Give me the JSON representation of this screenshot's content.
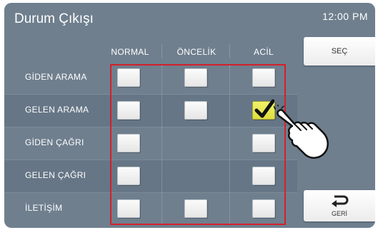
{
  "header": {
    "title": "Durum Çıkışı",
    "clock": "12:00 PM"
  },
  "columns": [
    "NORMAL",
    "ÖNCELİK",
    "ACİL"
  ],
  "rows": [
    {
      "label": "GİDEN ARAMA",
      "cells": [
        false,
        false,
        false
      ],
      "present": [
        true,
        true,
        true
      ]
    },
    {
      "label": "GELEN ARAMA",
      "cells": [
        false,
        false,
        true
      ],
      "present": [
        true,
        true,
        true
      ]
    },
    {
      "label": "GİDEN ÇAĞRI",
      "cells": [
        false,
        false,
        false
      ],
      "present": [
        true,
        false,
        true
      ]
    },
    {
      "label": "GELEN ÇAĞRI",
      "cells": [
        false,
        false,
        false
      ],
      "present": [
        true,
        false,
        true
      ]
    },
    {
      "label": "İLETİŞİM",
      "cells": [
        false,
        false,
        false
      ],
      "present": [
        true,
        true,
        true
      ]
    }
  ],
  "buttons": {
    "select": "SEÇ",
    "back": "GERİ"
  },
  "icons": {
    "check": "check-icon",
    "back": "return-arrow-icon",
    "hand": "pointing-hand-icon"
  },
  "colors": {
    "background": "#6f7f8e",
    "highlight": "#d4202a",
    "checked": "#e8e84a"
  }
}
